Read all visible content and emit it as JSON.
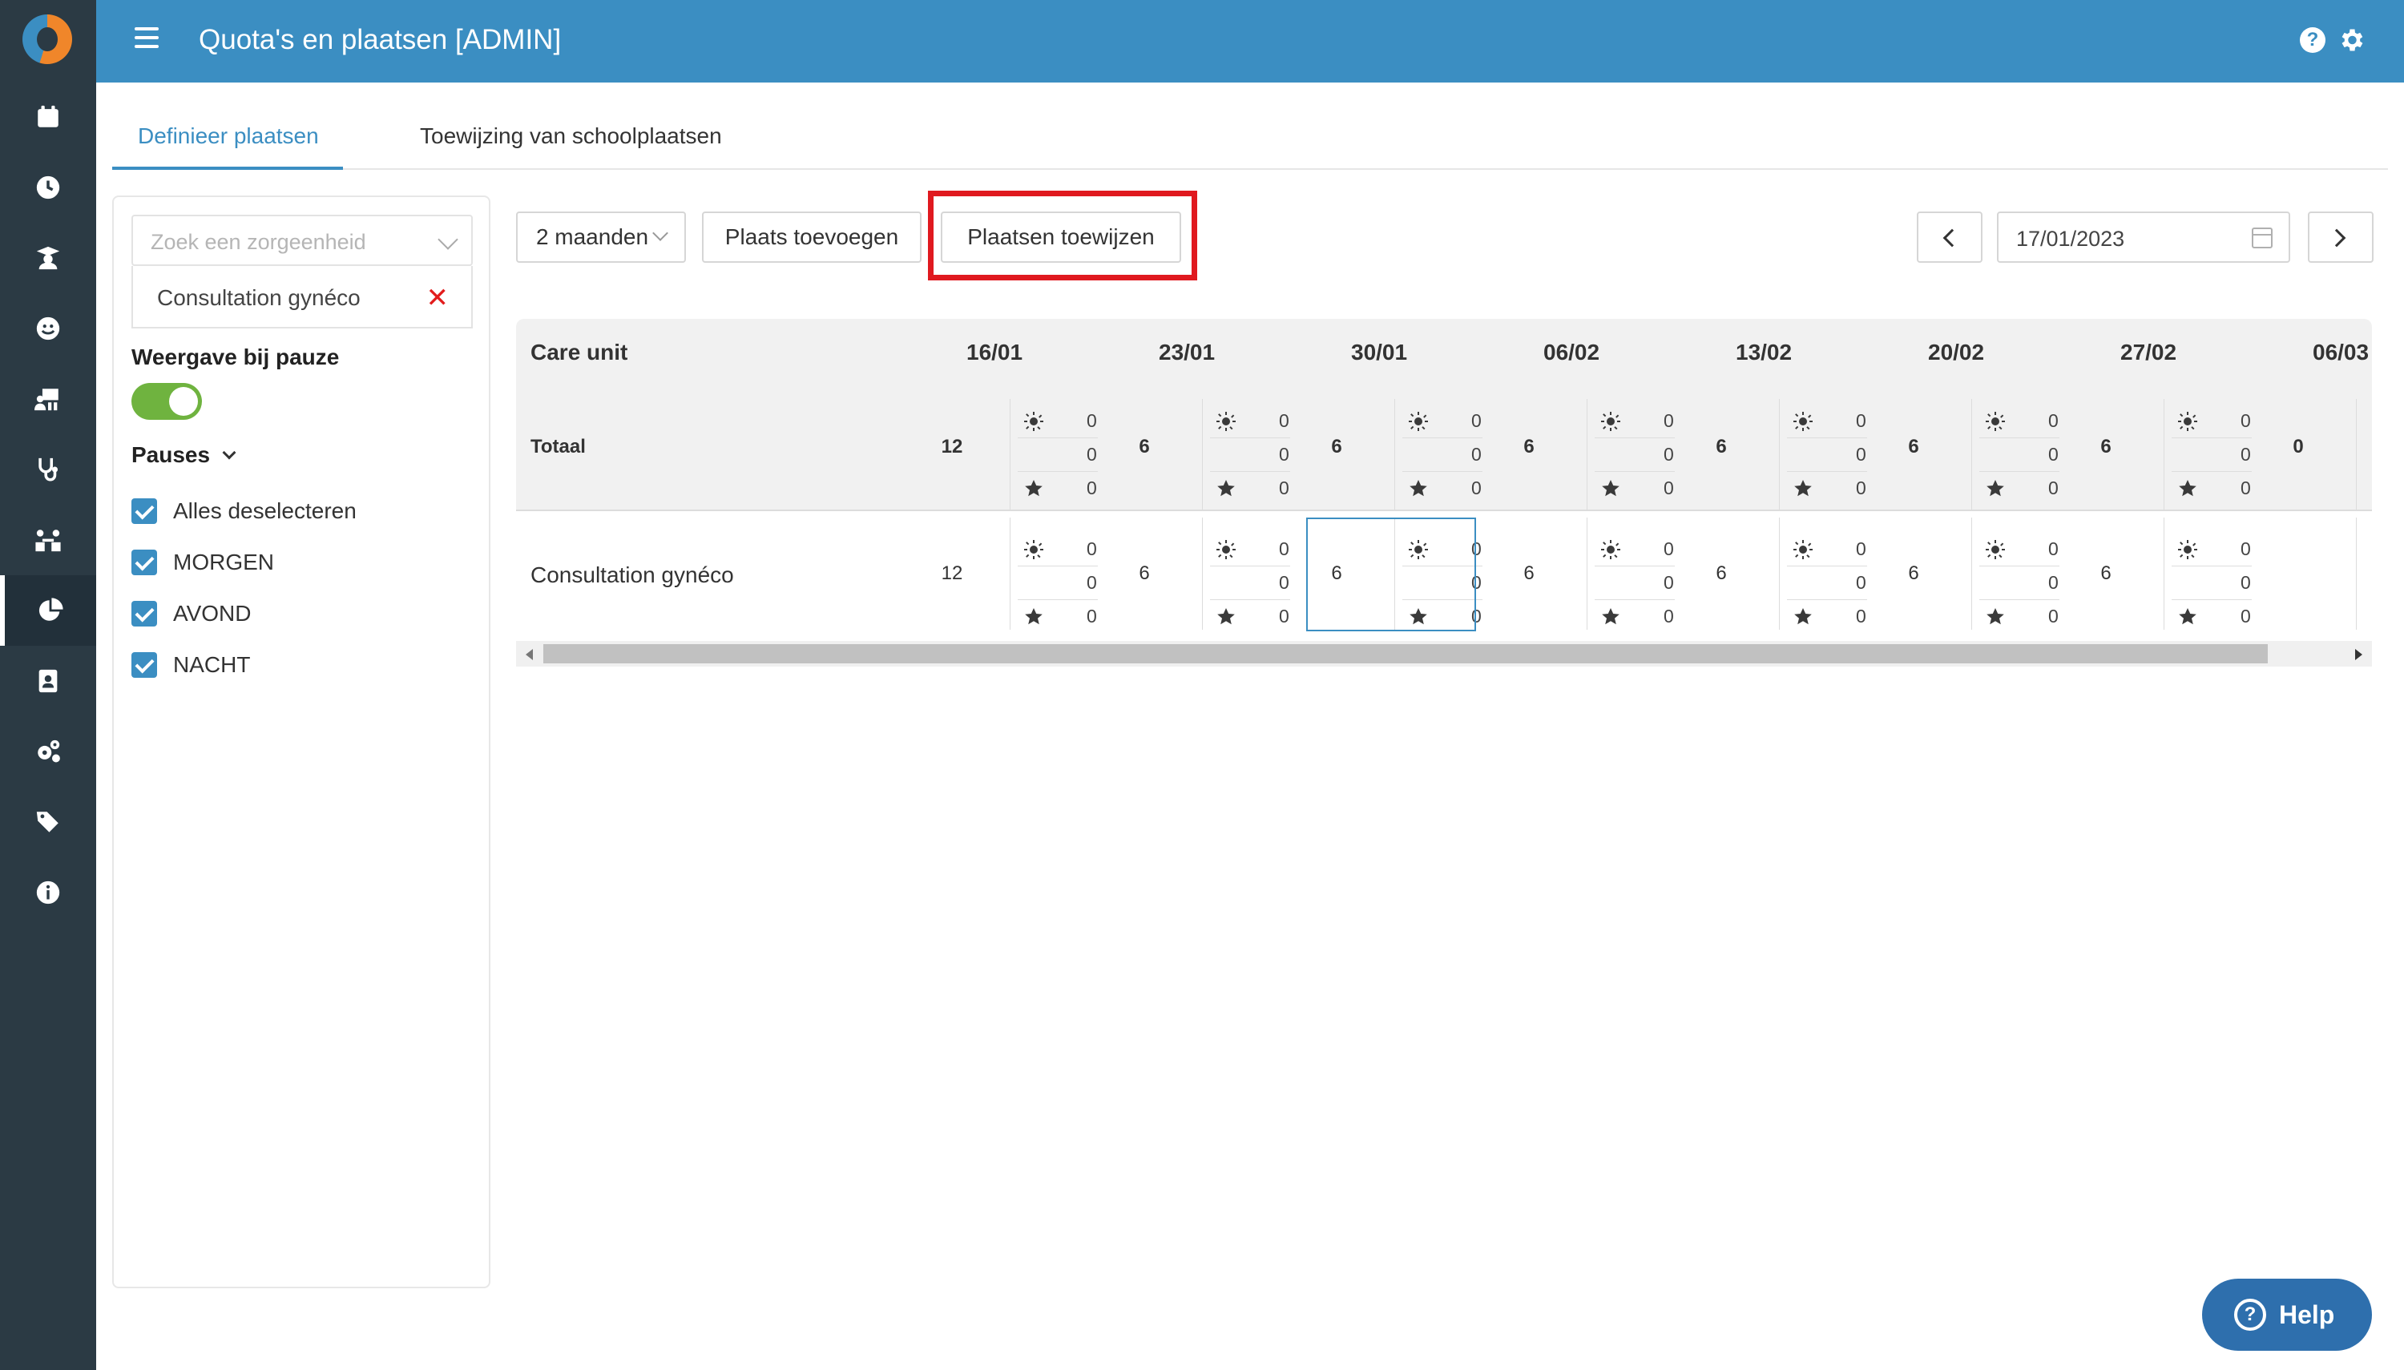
{
  "app": {
    "title": "Quota's en plaatsen [ADMIN]"
  },
  "rail": {
    "icons": [
      "calendar-icon",
      "clock-icon",
      "graduate-icon",
      "smile-icon",
      "people-board-icon",
      "stethoscope-icon",
      "users-link-icon",
      "pie-chart-icon",
      "badge-icon",
      "gears-icon",
      "tags-icon",
      "info-icon"
    ],
    "active": "pie-chart-icon"
  },
  "tabs": [
    {
      "label": "Definieer plaatsen",
      "active": true
    },
    {
      "label": "Toewijzing van schoolplaatsen",
      "active": false
    }
  ],
  "filters": {
    "search_placeholder": "Zoek een zorgeenheid",
    "selected_unit": "Consultation gynéco",
    "pause_view_label": "Weergave bij pauze",
    "pause_view_on": true,
    "pauses_label": "Pauses",
    "checks": [
      {
        "label": "Alles deselecteren",
        "checked": true
      },
      {
        "label": "MORGEN",
        "checked": true
      },
      {
        "label": "AVOND",
        "checked": true
      },
      {
        "label": "NACHT",
        "checked": true
      }
    ]
  },
  "toolbar": {
    "period": "2 maanden",
    "add_label": "Plaats toevoegen",
    "assign_label": "Plaatsen toewijzen",
    "date": "17/01/2023"
  },
  "grid": {
    "first_col": "Care unit",
    "weeks": [
      "16/01",
      "23/01",
      "30/01",
      "06/02",
      "13/02",
      "20/02",
      "27/02",
      "06/03"
    ],
    "rows": [
      {
        "label": "Totaal",
        "totals": [
          "12",
          "6",
          "6",
          "6",
          "6",
          "6",
          "6",
          "0"
        ],
        "shifts": [
          [
            "0",
            "0",
            "0"
          ],
          [
            "0",
            "0",
            "0"
          ],
          [
            "0",
            "0",
            "0"
          ],
          [
            "0",
            "0",
            "0"
          ],
          [
            "0",
            "0",
            "0"
          ],
          [
            "0",
            "0",
            "0"
          ],
          [
            "0",
            "0",
            "0"
          ]
        ]
      },
      {
        "label": "Consultation gynéco",
        "totals": [
          "12",
          "6",
          "6",
          "6",
          "6",
          "6",
          "6",
          ""
        ],
        "shifts": [
          [
            "0",
            "0",
            "0"
          ],
          [
            "0",
            "0",
            "0"
          ],
          [
            "0",
            "0",
            "0"
          ],
          [
            "0",
            "0",
            "0"
          ],
          [
            "0",
            "0",
            "0"
          ],
          [
            "0",
            "0",
            "0"
          ],
          [
            "0",
            "0",
            "0"
          ]
        ]
      }
    ],
    "shift_icons": [
      "sun-icon",
      "moon-icon",
      "star-icon"
    ]
  },
  "help": {
    "label": "Help"
  },
  "colors": {
    "brand": "#3b8ec2",
    "rail": "#2b3a44",
    "highlight": "#e0191f",
    "toggle": "#6fb33f"
  }
}
